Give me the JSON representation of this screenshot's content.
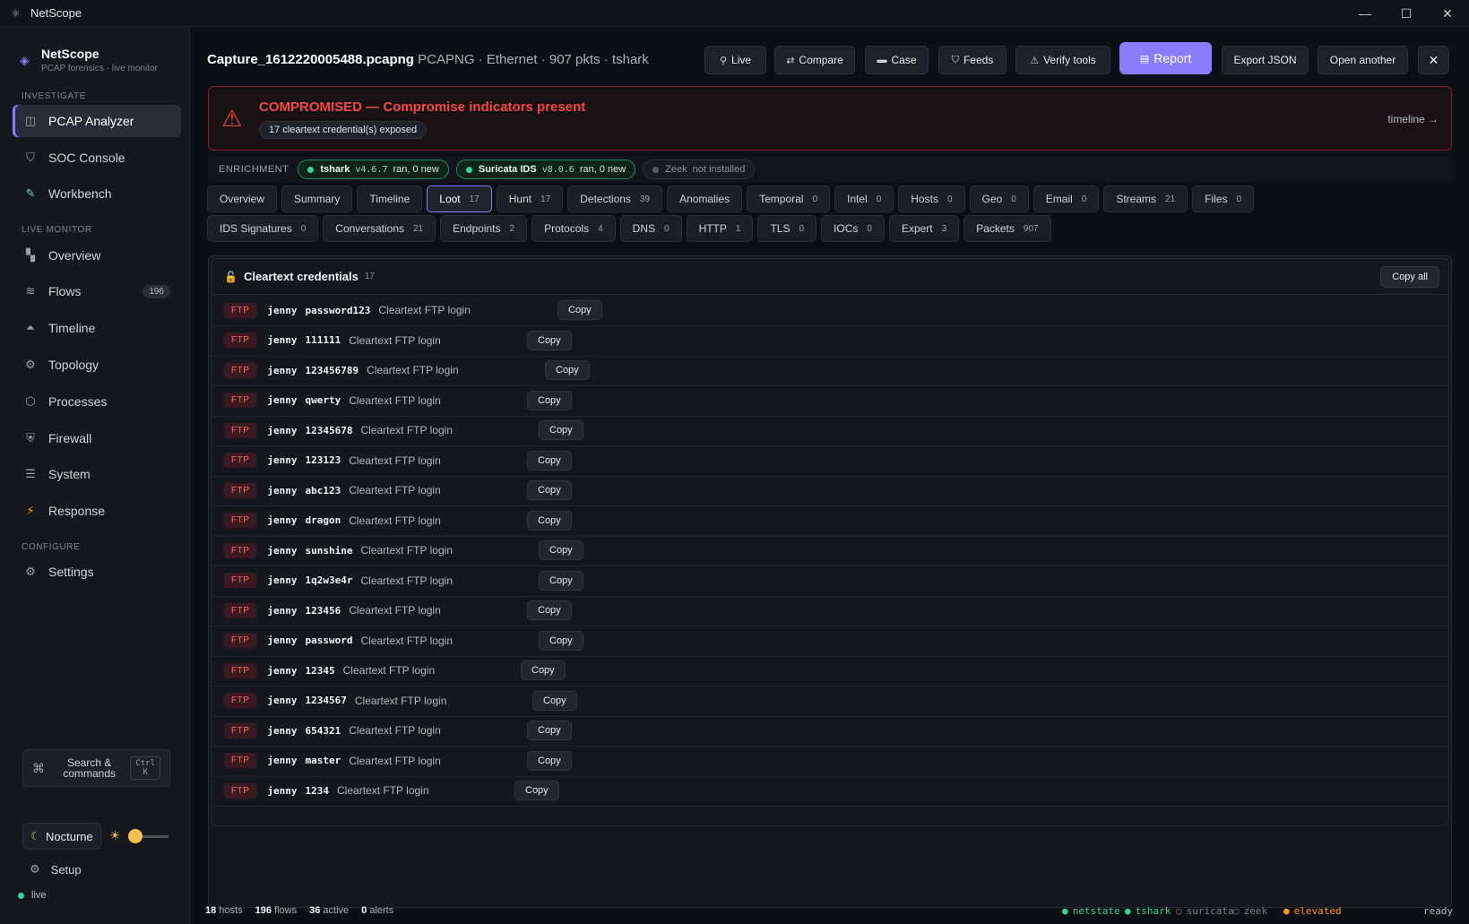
{
  "window": {
    "title": "NetScope"
  },
  "sidebar": {
    "brand": {
      "name": "NetScope",
      "subtitle": "PCAP forensics · live monitor"
    },
    "sections": {
      "investigate": "INVESTIGATE",
      "live_monitor": "LIVE MONITOR",
      "configure": "CONFIGURE"
    },
    "items": [
      {
        "label": "PCAP Analyzer",
        "icon": "window-icon",
        "active": true
      },
      {
        "label": "SOC Console",
        "icon": "shield-icon"
      },
      {
        "label": "Workbench",
        "icon": "wand-icon"
      },
      {
        "label": "Overview",
        "icon": "chart-icon"
      },
      {
        "label": "Flows",
        "icon": "flows-icon",
        "count": "196"
      },
      {
        "label": "Timeline",
        "icon": "timeline-icon"
      },
      {
        "label": "Topology",
        "icon": "topology-icon"
      },
      {
        "label": "Processes",
        "icon": "process-icon"
      },
      {
        "label": "Firewall",
        "icon": "firewall-icon"
      },
      {
        "label": "System",
        "icon": "system-icon"
      },
      {
        "label": "Response",
        "icon": "bolt-icon"
      },
      {
        "label": "Settings",
        "icon": "gear-icon"
      }
    ],
    "search": {
      "label_line1": "Search &",
      "label_line2": "commands",
      "kbd_line1": "Ctrl",
      "kbd_line2": "K"
    },
    "theme": {
      "label": "Nocturne",
      "brightness": 0.05
    },
    "setup_label": "Setup",
    "live_label": "live"
  },
  "header": {
    "file_name": "Capture_1612220005488.pcapng",
    "file_meta": " PCAPNG · Ethernet · 907 pkts · tshark",
    "buttons": {
      "live": "Live",
      "compare": "Compare",
      "case": "Case",
      "feeds": "Feeds",
      "verify": "Verify tools",
      "report": "Report",
      "export": "Export JSON",
      "open": "Open another",
      "close": "✕"
    }
  },
  "alert": {
    "title": "COMPROMISED — Compromise indicators present",
    "chip": "17 cleartext credential(s) exposed",
    "link": "timeline →"
  },
  "enrichment": {
    "label": "ENRICHMENT",
    "tools": [
      {
        "name": "tshark",
        "version": "v4.6.7",
        "status": "ran, 0 new",
        "ok": true
      },
      {
        "name": "Suricata IDS",
        "version": "v8.0.6",
        "status": "ran, 0 new",
        "ok": true
      },
      {
        "name": "Zeek",
        "version": "",
        "status": "not installed",
        "ok": false
      }
    ]
  },
  "tabs_row1": [
    {
      "label": "Overview",
      "count": ""
    },
    {
      "label": "Summary",
      "count": ""
    },
    {
      "label": "Timeline",
      "count": ""
    },
    {
      "label": "Loot",
      "count": "17",
      "active": true
    },
    {
      "label": "Hunt",
      "count": "17"
    },
    {
      "label": "Detections",
      "count": "39"
    },
    {
      "label": "Anomalies",
      "count": ""
    },
    {
      "label": "Temporal",
      "count": "0"
    },
    {
      "label": "Intel",
      "count": "0"
    },
    {
      "label": "Hosts",
      "count": "0"
    },
    {
      "label": "Geo",
      "count": "0"
    },
    {
      "label": "Email",
      "count": "0"
    },
    {
      "label": "Streams",
      "count": "21"
    },
    {
      "label": "Files",
      "count": "0"
    }
  ],
  "tabs_row2": [
    {
      "label": "IDS Signatures",
      "count": "0"
    },
    {
      "label": "Conversations",
      "count": "21"
    },
    {
      "label": "Endpoints",
      "count": "2"
    },
    {
      "label": "Protocols",
      "count": "4"
    },
    {
      "label": "DNS",
      "count": "0"
    },
    {
      "label": "HTTP",
      "count": "1"
    },
    {
      "label": "TLS",
      "count": "0"
    },
    {
      "label": "IOCs",
      "count": "0"
    },
    {
      "label": "Expert",
      "count": "3"
    },
    {
      "label": "Packets",
      "count": "907"
    }
  ],
  "credentials": {
    "title": "Cleartext credentials",
    "count": "17",
    "copy_all": "Copy all",
    "copy_label": "Copy",
    "rows": [
      {
        "proto": "FTP",
        "user": "jenny",
        "pass": "password123",
        "desc": "Cleartext FTP login"
      },
      {
        "proto": "FTP",
        "user": "jenny",
        "pass": "111111",
        "desc": "Cleartext FTP login"
      },
      {
        "proto": "FTP",
        "user": "jenny",
        "pass": "123456789",
        "desc": "Cleartext FTP login"
      },
      {
        "proto": "FTP",
        "user": "jenny",
        "pass": "qwerty",
        "desc": "Cleartext FTP login"
      },
      {
        "proto": "FTP",
        "user": "jenny",
        "pass": "12345678",
        "desc": "Cleartext FTP login"
      },
      {
        "proto": "FTP",
        "user": "jenny",
        "pass": "123123",
        "desc": "Cleartext FTP login"
      },
      {
        "proto": "FTP",
        "user": "jenny",
        "pass": "abc123",
        "desc": "Cleartext FTP login"
      },
      {
        "proto": "FTP",
        "user": "jenny",
        "pass": "dragon",
        "desc": "Cleartext FTP login"
      },
      {
        "proto": "FTP",
        "user": "jenny",
        "pass": "sunshine",
        "desc": "Cleartext FTP login"
      },
      {
        "proto": "FTP",
        "user": "jenny",
        "pass": "1q2w3e4r",
        "desc": "Cleartext FTP login"
      },
      {
        "proto": "FTP",
        "user": "jenny",
        "pass": "123456",
        "desc": "Cleartext FTP login"
      },
      {
        "proto": "FTP",
        "user": "jenny",
        "pass": "password",
        "desc": "Cleartext FTP login"
      },
      {
        "proto": "FTP",
        "user": "jenny",
        "pass": "12345",
        "desc": "Cleartext FTP login"
      },
      {
        "proto": "FTP",
        "user": "jenny",
        "pass": "1234567",
        "desc": "Cleartext FTP login"
      },
      {
        "proto": "FTP",
        "user": "jenny",
        "pass": "654321",
        "desc": "Cleartext FTP login"
      },
      {
        "proto": "FTP",
        "user": "jenny",
        "pass": "master",
        "desc": "Cleartext FTP login"
      },
      {
        "proto": "FTP",
        "user": "jenny",
        "pass": "1234",
        "desc": "Cleartext FTP login"
      }
    ]
  },
  "statusbar": {
    "hosts": "18",
    "hosts_label": " hosts",
    "flows": "196",
    "flows_label": " flows",
    "active": "36",
    "active_label": " active",
    "alerts": "0",
    "alerts_label": " alerts",
    "services": [
      {
        "name": "netstate",
        "state": "on",
        "color": "#34d399"
      },
      {
        "name": "tshark",
        "state": "on",
        "color": "#34d399"
      },
      {
        "name": "suricata",
        "state": "off",
        "color": "#6b7080"
      },
      {
        "name": "zeek",
        "state": "off",
        "color": "#6b7080"
      },
      {
        "name": "elevated",
        "state": "warn",
        "color": "#f59e0b"
      }
    ],
    "ready": "ready"
  },
  "colors": {
    "accent": "#8b7bff",
    "danger": "#ef4444",
    "ok": "#34d399",
    "warn": "#f59e0b"
  }
}
